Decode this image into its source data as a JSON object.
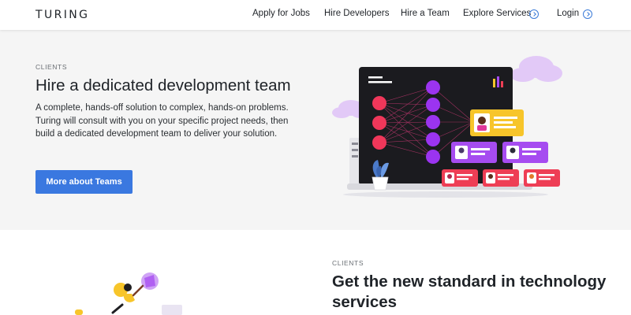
{
  "header": {
    "logo": "TURING",
    "nav": {
      "apply": "Apply for Jobs",
      "hire_developers": "Hire Developers",
      "hire_team": "Hire a Team",
      "explore": "Explore Services",
      "login": "Login"
    }
  },
  "hero": {
    "eyebrow": "CLIENTS",
    "title": "Hire a dedicated development team",
    "body": "A complete, hands-off solution to complex, hands-on problems. Turing will consult with you on your specific project needs, then build a dedicated development team to deliver your solution.",
    "cta": "More about Teams"
  },
  "section2": {
    "eyebrow": "CLIENTS",
    "title": "Get the new standard in technology services"
  },
  "colors": {
    "accent": "#3a78e0",
    "hero_bg": "#f5f5f5",
    "node_red": "#f0375a",
    "node_purple": "#9b34f0",
    "card_yellow": "#f7c52a",
    "card_purple": "#a64cf0",
    "card_red": "#ee3e55"
  },
  "icons": {
    "explore": "chevron-circle-icon",
    "login": "chevron-circle-icon"
  }
}
